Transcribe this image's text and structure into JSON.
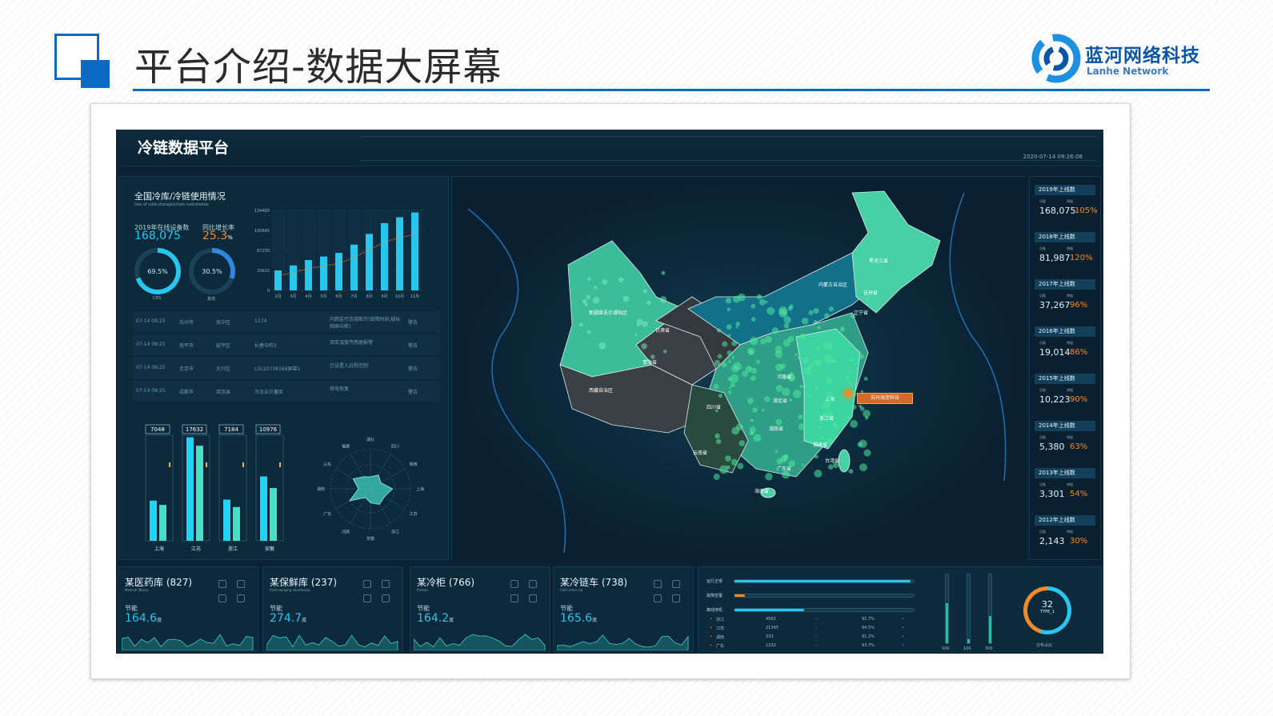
{
  "slide": {
    "title": "平台介绍-数据大屏幕",
    "logo_name": "蓝河网络科技",
    "logo_en": "Lanhe Network",
    "accent": "#0b6bc4"
  },
  "dashboard": {
    "title": "冷链数据平台",
    "datetime": "2020-07-14 09:26:08",
    "left_panel": {
      "title": "全国冷库/冷链使用情况",
      "subtitle": "Use of cold storage/chain nationwide",
      "stat1_label": "2019年在线设备数",
      "stat1_value": "168,075",
      "stat2_label": "同比增长率",
      "stat2_value": "25.3",
      "stat2_unit": "%",
      "ring1_value": "69.5%",
      "ring1_label": "CRS",
      "ring2_value": "30.5%",
      "ring2_label": "其他",
      "chart_y_ticks": [
        "134480",
        "100845",
        "67230",
        "33615",
        "0"
      ],
      "alarms": [
        {
          "time": "07-14 09:25",
          "city": "苏州市",
          "district": "吴中区",
          "id": "1174",
          "msg": "问题监控连接断开(故障时刻,疑似网络中断)",
          "level": "警告"
        },
        {
          "time": "07-14 09:25",
          "city": "南平市",
          "district": "延平区",
          "id": "长春中药3",
          "msg": "双库温度传感器报警",
          "level": "警告"
        },
        {
          "time": "07-14 09:25",
          "city": "北京市",
          "district": "大兴区",
          "id": "L3120738168屏幕1",
          "msg": "已设置入远程控制",
          "level": "警告"
        },
        {
          "time": "07-14 09:25",
          "city": "成都市",
          "district": "双流县",
          "id": "冷冻云贝蓄库",
          "msg": "供电恢复",
          "level": "警告"
        }
      ],
      "bar_groups": [
        {
          "label": "上海",
          "value": "7048"
        },
        {
          "label": "江苏",
          "value": "17632"
        },
        {
          "label": "浙江",
          "value": "7184"
        },
        {
          "label": "安徽",
          "value": "10976"
        }
      ],
      "radar_labels": [
        "湖北",
        "四川",
        "陕西",
        "上海",
        "江苏",
        "浙江",
        "安徽",
        "河南",
        "广东",
        "湖南",
        "山东",
        "福建"
      ]
    },
    "map": {
      "labels": [
        {
          "text": "新疆维吾尔自治区",
          "cls": "xinjiang"
        },
        {
          "text": "西藏自治区",
          "cls": "xizang"
        },
        {
          "text": "青海省",
          "cls": "qinghai"
        },
        {
          "text": "甘肃省",
          "cls": "gansu"
        },
        {
          "text": "内蒙古自治区",
          "cls": "neimenggu"
        },
        {
          "text": "黑龙江省",
          "cls": "heilongjiang"
        },
        {
          "text": "吉林省",
          "cls": "jilin"
        },
        {
          "text": "辽宁省",
          "cls": "liaoning"
        },
        {
          "text": "四川省",
          "cls": "sichuan"
        },
        {
          "text": "云南省",
          "cls": "yunnan"
        },
        {
          "text": "湖北省",
          "cls": "hubei"
        },
        {
          "text": "湖南省",
          "cls": "hunan"
        },
        {
          "text": "河南省",
          "cls": "henan"
        },
        {
          "text": "广东省",
          "cls": "guangdong"
        },
        {
          "text": "浙江省",
          "cls": "zhejiang"
        },
        {
          "text": "福建省",
          "cls": "fujian"
        },
        {
          "text": "上海",
          "cls": "shanghai"
        },
        {
          "text": "海南省",
          "cls": "hainan"
        },
        {
          "text": "台湾省",
          "cls": "taiwan"
        }
      ],
      "tooltip": "苏州海堂科技"
    },
    "year_cards": [
      {
        "title": "2019年上线数",
        "sub1": "设备",
        "sub2": "增幅",
        "value": "168,075",
        "pct": "105%"
      },
      {
        "title": "2018年上线数",
        "sub1": "设备",
        "sub2": "增幅",
        "value": "81,987",
        "pct": "120%"
      },
      {
        "title": "2017年上线数",
        "sub1": "设备",
        "sub2": "增幅",
        "value": "37,267",
        "pct": "96%"
      },
      {
        "title": "2016年上线数",
        "sub1": "设备",
        "sub2": "增幅",
        "value": "19,014",
        "pct": "86%"
      },
      {
        "title": "2015年上线数",
        "sub1": "设备",
        "sub2": "增幅",
        "value": "10,223",
        "pct": "90%"
      },
      {
        "title": "2014年上线数",
        "sub1": "设备",
        "sub2": "增幅",
        "value": "5,380",
        "pct": "63%"
      },
      {
        "title": "2013年上线数",
        "sub1": "设备",
        "sub2": "增幅",
        "value": "3,301",
        "pct": "54%"
      },
      {
        "title": "2012年上线数",
        "sub1": "设备",
        "sub2": "增幅",
        "value": "2,143",
        "pct": "30%"
      }
    ],
    "bottom_cards": [
      {
        "title": "某医药库 (827)",
        "sub": "Medical library",
        "unit_label": "节能",
        "value": "164.6",
        "unit": "度"
      },
      {
        "title": "某保鲜库 (237)",
        "sub": "fresh-keeping storehouse",
        "unit_label": "节能",
        "value": "274.7",
        "unit": "度"
      },
      {
        "title": "某冷柜 (766)",
        "sub": "freezer",
        "unit_label": "节能",
        "value": "164.2",
        "unit": "度"
      },
      {
        "title": "某冷链车 (738)",
        "sub": "Cold chain car",
        "unit_label": "节能",
        "value": "165.6",
        "unit": "度"
      }
    ],
    "status_panel": {
      "bars": [
        {
          "label": "运行正常",
          "fill": 0.98,
          "color": "#27c6ee"
        },
        {
          "label": "故障告警",
          "fill": 0.06,
          "color": "#f28a26"
        },
        {
          "label": "离线停机",
          "fill": 0.39,
          "color": "#27c6ee"
        }
      ],
      "provinces": [
        {
          "name": "浙江",
          "count": "4562",
          "dash": "-",
          "pct": "91.7%"
        },
        {
          "name": "江苏",
          "count": "21345",
          "dash": "-",
          "pct": "94.5%"
        },
        {
          "name": "湖南",
          "count": "233",
          "dash": "-",
          "pct": "91.2%"
        },
        {
          "name": "广东",
          "count": "1232",
          "dash": "-",
          "pct": "93.7%"
        }
      ],
      "gauge_ticks": [
        "500",
        "100",
        "300"
      ],
      "donut_value": "32",
      "donut_type": "TYPE_1",
      "donut_label": "分布占比"
    }
  },
  "chart_data": {
    "type": "bar",
    "categories": [
      "2月",
      "3月",
      "4月",
      "5月",
      "6月",
      "7月",
      "8月",
      "9月",
      "10月",
      "11月"
    ],
    "values": [
      33615,
      42000,
      51000,
      57000,
      63000,
      77000,
      95000,
      113000,
      123000,
      131000
    ],
    "ylim": [
      0,
      134480
    ],
    "yticks": [
      0,
      33615,
      67230,
      100845,
      134480
    ],
    "colors": {
      "bar": "#27c6ee",
      "trend": "#f28a26"
    }
  }
}
